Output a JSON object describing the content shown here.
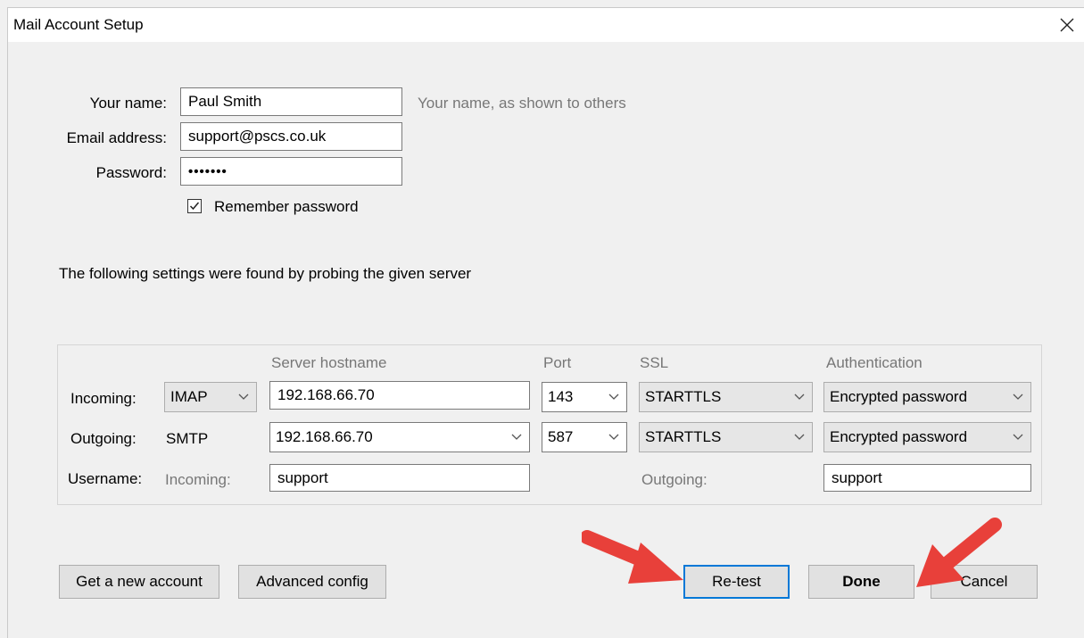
{
  "window": {
    "title": "Mail Account Setup"
  },
  "account": {
    "name_label": "Your name:",
    "name_value": "Paul Smith",
    "name_hint": "Your name, as shown to others",
    "email_label": "Email address:",
    "email_value": "support@pscs.co.uk",
    "password_label": "Password:",
    "password_value": "•••••••",
    "remember_label": "Remember password",
    "remember_checked": true
  },
  "probe_message": "The following settings were found by probing the given server",
  "server": {
    "headers": {
      "hostname": "Server hostname",
      "port": "Port",
      "ssl": "SSL",
      "auth": "Authentication"
    },
    "incoming": {
      "label": "Incoming:",
      "protocol": "IMAP",
      "hostname": "192.168.66.70",
      "port": "143",
      "ssl": "STARTTLS",
      "auth": "Encrypted password"
    },
    "outgoing": {
      "label": "Outgoing:",
      "protocol": "SMTP",
      "hostname": "192.168.66.70",
      "port": "587",
      "ssl": "STARTTLS",
      "auth": "Encrypted password"
    },
    "username": {
      "label": "Username:",
      "incoming_label": "Incoming:",
      "incoming_value": "support",
      "outgoing_label": "Outgoing:",
      "outgoing_value": "support"
    }
  },
  "buttons": {
    "new_account": "Get a new account",
    "advanced": "Advanced config",
    "retest": "Re-test",
    "done": "Done",
    "cancel": "Cancel"
  },
  "colors": {
    "accent": "#0078d7",
    "annotation_arrow": "#e8403a"
  },
  "icons": {
    "close": "close-icon",
    "dropdown": "chevron-down-icon",
    "check": "checkmark-icon",
    "annotation": "red-arrow-icon"
  }
}
